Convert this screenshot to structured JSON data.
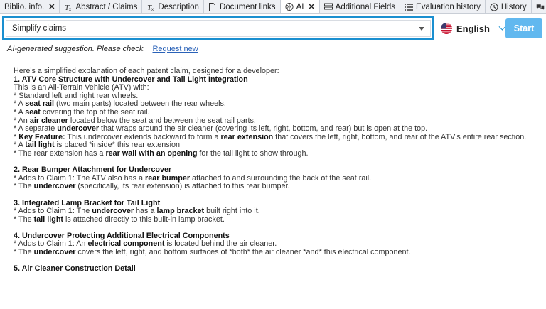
{
  "tabs": [
    {
      "label": "Biblio. info.",
      "icon": "none",
      "closable": true,
      "active": false
    },
    {
      "label": "Abstract / Claims",
      "icon": "italic-text-icon",
      "closable": false,
      "active": false
    },
    {
      "label": "Description",
      "icon": "italic-text-icon",
      "closable": false,
      "active": false
    },
    {
      "label": "Document links",
      "icon": "document-icon",
      "closable": false,
      "active": false
    },
    {
      "label": "AI",
      "icon": "ai-brain-icon",
      "closable": true,
      "active": true
    },
    {
      "label": "Additional Fields",
      "icon": "fields-icon",
      "closable": false,
      "active": false
    },
    {
      "label": "Evaluation history",
      "icon": "list-icon",
      "closable": false,
      "active": false
    },
    {
      "label": "History",
      "icon": "clock-icon",
      "closable": false,
      "active": false
    }
  ],
  "header": {
    "prompt_select_value": "Simplify claims",
    "language": "English",
    "start_label": "Start"
  },
  "note": {
    "text": "AI-generated suggestion. Please check.",
    "link": "Request new"
  },
  "content": {
    "intro": "Here's a simplified explanation of each patent claim, designed for a developer:",
    "c1_title": "1. ATV Core Structure with Undercover and Tail Light Integration",
    "c1_l1": "This is an All-Terrain Vehicle (ATV) with:",
    "c1_l2": "* Standard left and right rear wheels.",
    "c1_l3a": "* A ",
    "c1_l3b": "seat rail",
    "c1_l3c": " (two main parts) located between the rear wheels.",
    "c1_l4a": "* A ",
    "c1_l4b": "seat",
    "c1_l4c": " covering the top of the seat rail.",
    "c1_l5a": "* An ",
    "c1_l5b": "air cleaner",
    "c1_l5c": " located below the seat and between the seat rail parts.",
    "c1_l6a": "* A separate ",
    "c1_l6b": "undercover",
    "c1_l6c": " that wraps around the air cleaner (covering its left, right, bottom, and rear) but is open at the top.",
    "c1_l7a": "* ",
    "c1_l7b": "Key Feature:",
    "c1_l7c": " This undercover extends backward to form a ",
    "c1_l7d": "rear extension",
    "c1_l7e": " that covers the left, right, bottom, and rear of the ATV's entire rear section.",
    "c1_l8a": "* A ",
    "c1_l8b": "tail light",
    "c1_l8c": " is placed *inside* this rear extension.",
    "c1_l9a": "* The rear extension has a ",
    "c1_l9b": "rear wall with an opening",
    "c1_l9c": " for the tail light to show through.",
    "c2_title": "2. Rear Bumper Attachment for Undercover",
    "c2_l1a": "* Adds to Claim 1: The ATV also has a ",
    "c2_l1b": "rear bumper",
    "c2_l1c": " attached to and surrounding the back of the seat rail.",
    "c2_l2a": "* The ",
    "c2_l2b": "undercover",
    "c2_l2c": " (specifically, its rear extension) is attached to this rear bumper.",
    "c3_title": "3. Integrated Lamp Bracket for Tail Light",
    "c3_l1a": "* Adds to Claim 1: The ",
    "c3_l1b": "undercover",
    "c3_l1c": " has a ",
    "c3_l1d": "lamp bracket",
    "c3_l1e": " built right into it.",
    "c3_l2a": "* The ",
    "c3_l2b": "tail light",
    "c3_l2c": " is attached directly to this built-in lamp bracket.",
    "c4_title": "4. Undercover Protecting Additional Electrical Components",
    "c4_l1a": "* Adds to Claim 1: An ",
    "c4_l1b": "electrical component",
    "c4_l1c": " is located behind the air cleaner.",
    "c4_l2a": "* The ",
    "c4_l2b": "undercover",
    "c4_l2c": " covers the left, right, and bottom surfaces of *both* the air cleaner *and* this electrical component.",
    "c5_title": "5. Air Cleaner Construction Detail"
  },
  "colors": {
    "accent": "#1a8fd0",
    "start_button": "#61b8ef",
    "link": "#2a62b8"
  }
}
